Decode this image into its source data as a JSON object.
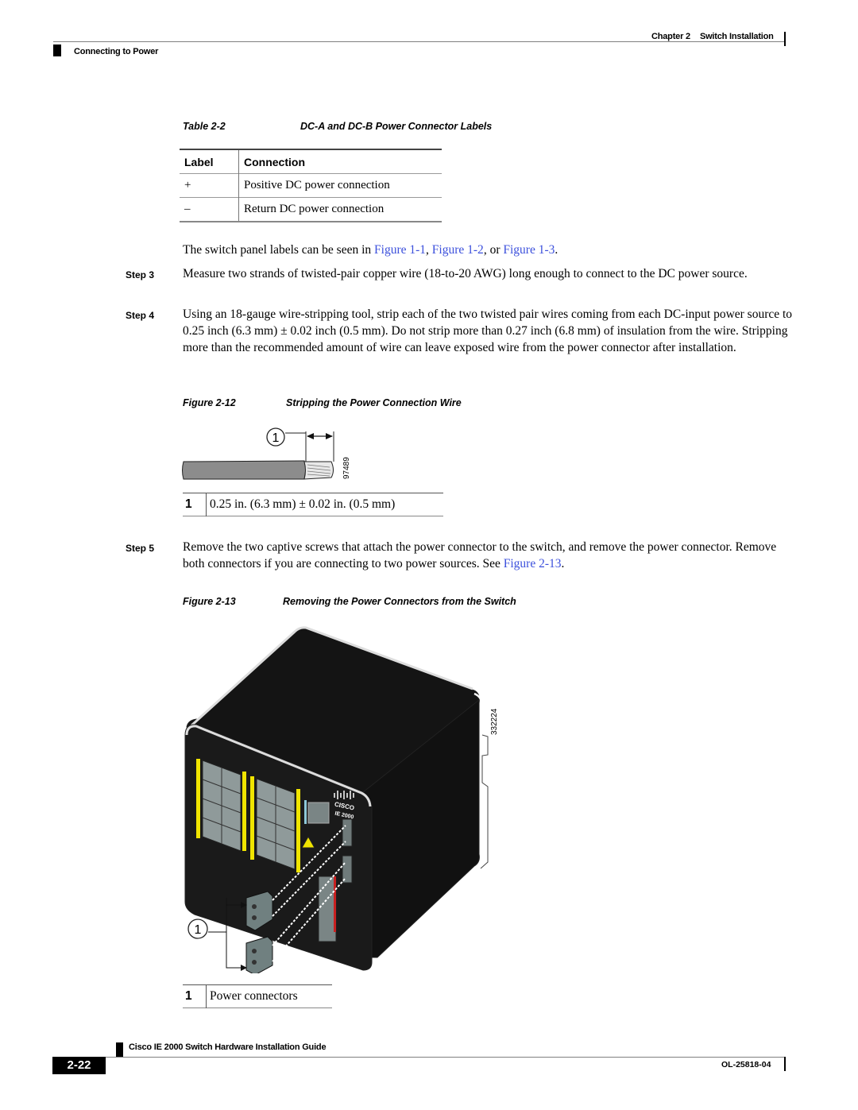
{
  "header": {
    "chapter_label": "Chapter 2",
    "chapter_title": "Switch Installation",
    "section": "Connecting to Power"
  },
  "table": {
    "caption_num": "Table 2-2",
    "caption_title": "DC-A and DC-B Power Connector Labels",
    "columns": [
      "Label",
      "Connection"
    ],
    "rows": [
      [
        "+",
        "Positive DC power connection"
      ],
      [
        "–",
        "Return DC power connection"
      ]
    ]
  },
  "panel_labels": {
    "text_before": "The switch panel labels can be seen in ",
    "link1": "Figure 1-1",
    "sep1": ", ",
    "link2": "Figure 1-2",
    "sep2": ", or ",
    "link3": "Figure 1-3",
    "text_after": "."
  },
  "steps": [
    {
      "label": "Step 3",
      "text": "Measure two strands of twisted-pair copper wire (18-to-20 AWG) long enough to connect to the DC power source."
    },
    {
      "label": "Step 4",
      "text": "Using an 18-gauge wire-stripping tool, strip each of the two twisted pair wires coming from each DC-input power source to 0.25 inch (6.3 mm) ± 0.02 inch (0.5 mm). Do not strip more than 0.27 inch (6.8 mm) of insulation from the wire. Stripping more than the recommended amount of wire can leave exposed wire from the power connector after installation."
    },
    {
      "label": "Step 5",
      "text": "Remove the two captive screws that attach the power connector to the switch, and remove the power connector. Remove both connectors if you are connecting to two power sources. See ",
      "link": "Figure 2-13",
      "text_after": "."
    }
  ],
  "figure12": {
    "caption_num": "Figure 2-12",
    "caption_title": "Stripping the Power Connection Wire",
    "callout": "1",
    "art_id": "97489",
    "legend": [
      {
        "num": "1",
        "text": "0.25 in. (6.3 mm) ± 0.02 in. (0.5 mm)"
      }
    ]
  },
  "figure13": {
    "caption_num": "Figure 2-13",
    "caption_title": "Removing the Power Connectors from the Switch",
    "callout": "1",
    "art_id": "332224",
    "brand": "CISCO",
    "model": "IE 2000",
    "legend": [
      {
        "num": "1",
        "text": "Power connectors"
      }
    ]
  },
  "footer": {
    "guide_title": "Cisco IE 2000 Switch Hardware Installation Guide",
    "page_number": "2-22",
    "doc_number": "OL-25818-04"
  }
}
